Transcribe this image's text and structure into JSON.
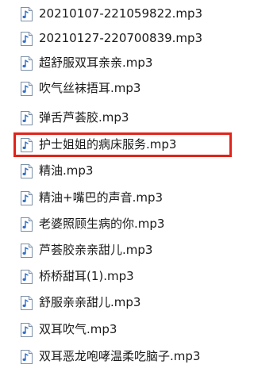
{
  "file_icon": "audio-file-icon",
  "colors": {
    "highlight_border": "#e0241b",
    "icon_note": "#2f6fc8",
    "text": "#1a1a1a"
  },
  "files": [
    {
      "name": "20210107-221059822.mp3"
    },
    {
      "name": "20210127-220700839.mp3"
    },
    {
      "name": "超舒服双耳亲亲.mp3"
    },
    {
      "name": "吹气丝袜捂耳.mp3"
    },
    {
      "name": "弹舌芦荟胶.mp3"
    },
    {
      "name": "护士姐姐的病床服务.mp3",
      "highlighted": true
    },
    {
      "name": "精油.mp3"
    },
    {
      "name": "精油+嘴巴的声音.mp3"
    },
    {
      "name": "老婆照顾生病的你.mp3"
    },
    {
      "name": "芦荟胶亲亲甜儿.mp3"
    },
    {
      "name": "桥桥甜耳(1).mp3"
    },
    {
      "name": "舒服亲亲甜儿.mp3"
    },
    {
      "name": "双耳吹气.mp3"
    },
    {
      "name": "双耳恶龙咆哮温柔吃脑子.mp3"
    }
  ]
}
